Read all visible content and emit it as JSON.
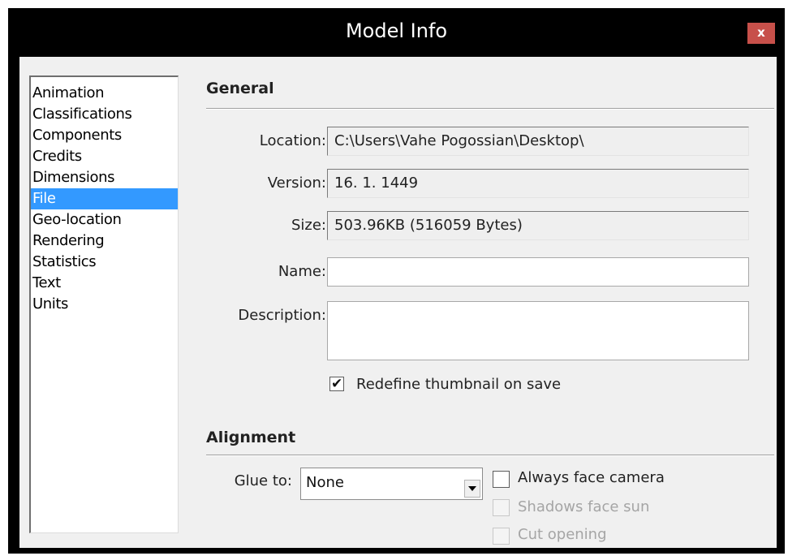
{
  "window": {
    "title": "Model Info",
    "close_label": "x"
  },
  "sidebar": {
    "items": [
      {
        "label": "Animation",
        "selected": false
      },
      {
        "label": "Classifications",
        "selected": false
      },
      {
        "label": "Components",
        "selected": false
      },
      {
        "label": "Credits",
        "selected": false
      },
      {
        "label": "Dimensions",
        "selected": false
      },
      {
        "label": "File",
        "selected": true
      },
      {
        "label": "Geo-location",
        "selected": false
      },
      {
        "label": "Rendering",
        "selected": false
      },
      {
        "label": "Statistics",
        "selected": false
      },
      {
        "label": "Text",
        "selected": false
      },
      {
        "label": "Units",
        "selected": false
      }
    ]
  },
  "general": {
    "title": "General",
    "location_label": "Location:",
    "location_value": "C:\\Users\\Vahe Pogossian\\Desktop\\",
    "version_label": "Version:",
    "version_value": "16. 1. 1449",
    "size_label": "Size:",
    "size_value": "503.96KB (516059 Bytes)",
    "name_label": "Name:",
    "name_value": "",
    "description_label": "Description:",
    "description_value": "",
    "redefine_thumbnail_label": "Redefine thumbnail on save",
    "redefine_thumbnail_checked": true
  },
  "alignment": {
    "title": "Alignment",
    "glue_label": "Glue to:",
    "glue_value": "None",
    "always_face_camera_label": "Always face camera",
    "always_face_camera_checked": false,
    "shadows_face_sun_label": "Shadows face sun",
    "shadows_face_sun_enabled": false,
    "cut_opening_label": "Cut opening",
    "cut_opening_enabled": false
  },
  "colors": {
    "selection": "#3399ff",
    "close_button": "#c7504a",
    "title_bar": "#000000"
  }
}
